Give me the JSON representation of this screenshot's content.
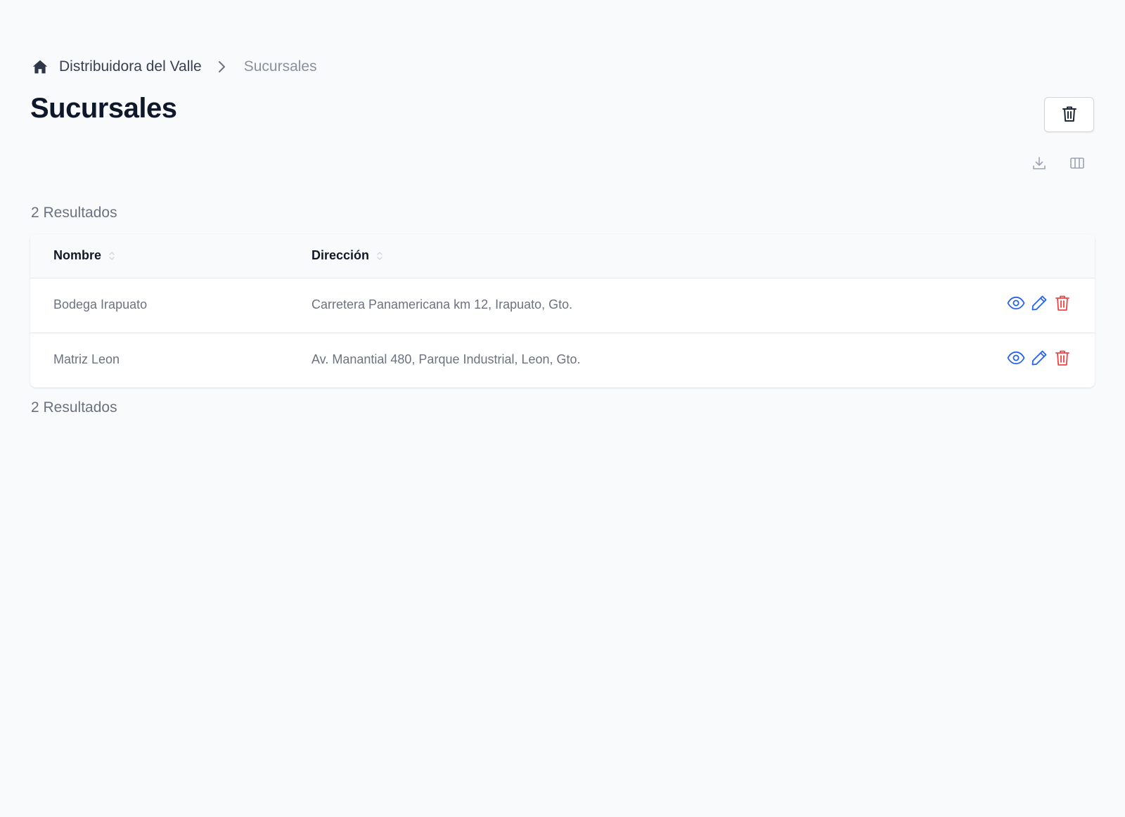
{
  "breadcrumb": {
    "home_icon": "home-icon",
    "company": "Distribuidora del Valle",
    "separator_icon": "chevron-right-icon",
    "current": "Sucursales"
  },
  "page": {
    "title": "Sucursales"
  },
  "header_actions": {
    "trash_icon": "trash-icon"
  },
  "toolbar": {
    "download_icon": "download-icon",
    "columns_icon": "columns-icon"
  },
  "results": {
    "top": "2 Resultados",
    "bottom": "2 Resultados"
  },
  "table": {
    "columns": [
      {
        "label": "Nombre",
        "sortable": true
      },
      {
        "label": "Dirección",
        "sortable": true
      }
    ],
    "rows": [
      {
        "nombre": "Bodega Irapuato",
        "direccion": "Carretera Panamericana km 12, Irapuato, Gto."
      },
      {
        "nombre": "Matriz Leon",
        "direccion": "Av. Manantial 480, Parque Industrial, Leon, Gto."
      }
    ],
    "row_actions": [
      "eye-icon",
      "pencil-icon",
      "trash-icon"
    ]
  },
  "colors": {
    "background": "#f9fafc",
    "action_blue": "#2563eb",
    "action_red": "#ef4444",
    "muted_text": "#6b7280"
  }
}
